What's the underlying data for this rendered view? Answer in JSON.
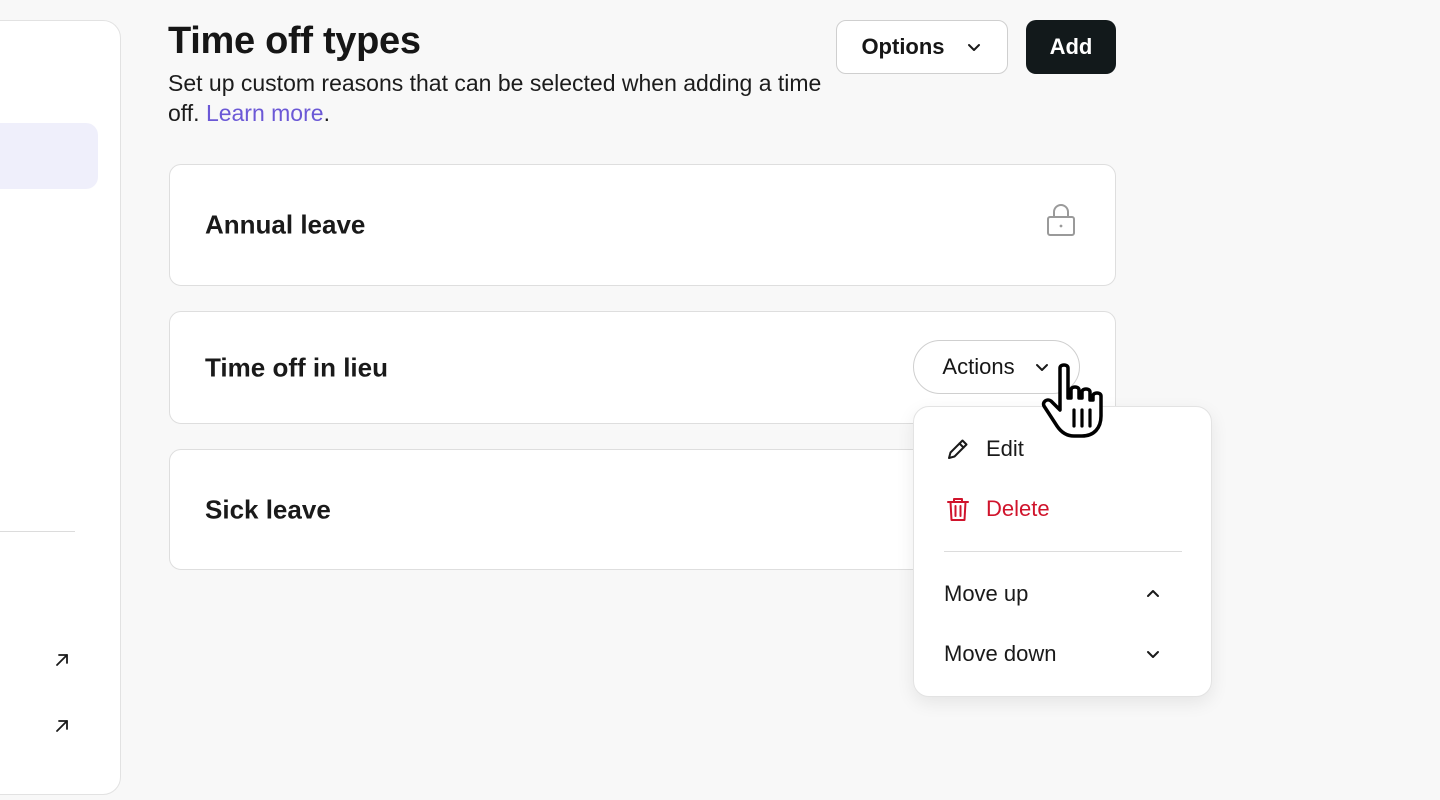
{
  "page": {
    "title": "Time off types",
    "description_text": "Set up custom reasons that can be selected when adding a time off.",
    "learn_more_label": "Learn more",
    "description_suffix": "."
  },
  "header": {
    "options_label": "Options",
    "add_label": "Add"
  },
  "time_off_types": [
    {
      "label": "Annual leave",
      "icon": "lock-icon"
    },
    {
      "label": "Time off in lieu",
      "action_label": "Actions"
    },
    {
      "label": "Sick leave"
    }
  ],
  "actions_menu": {
    "items": [
      {
        "label": "Edit",
        "icon": "pencil-icon"
      },
      {
        "label": "Delete",
        "icon": "trash-icon",
        "color": "#d0142c"
      },
      {
        "label": "Move up",
        "icon": "chevron-up-icon"
      },
      {
        "label": "Move down",
        "icon": "chevron-down-icon"
      }
    ]
  },
  "colors": {
    "accent_link": "#6b58d6",
    "primary_button": "#12191b",
    "danger": "#d0142c",
    "sidebar_active": "#efeffb"
  }
}
